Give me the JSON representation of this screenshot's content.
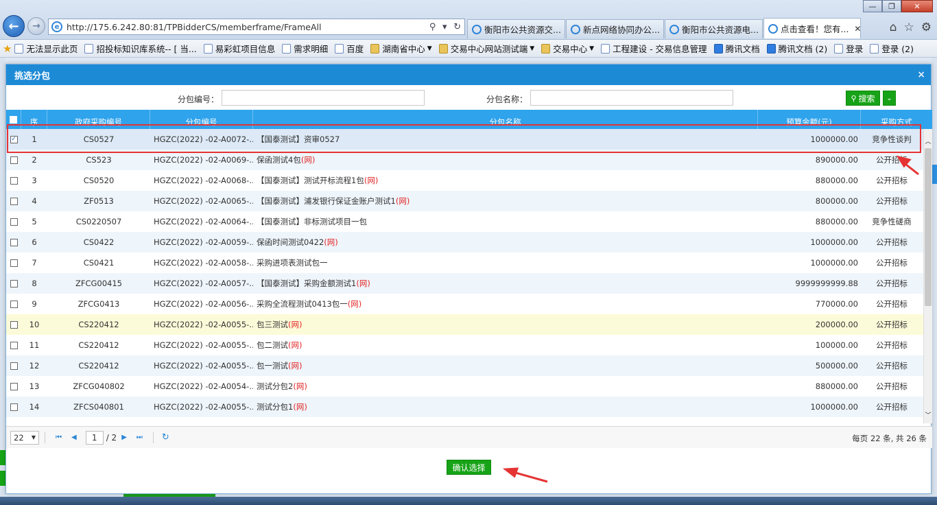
{
  "browser": {
    "url": "http://175.6.242.80:81/TPBidderCS/memberframe/FrameAll",
    "tabs": [
      {
        "label": "衡阳市公共资源交..."
      },
      {
        "label": "新点网络协同办公..."
      },
      {
        "label": "衡阳市公共资源电..."
      },
      {
        "label": "点击查看！您有..."
      }
    ],
    "favorites": [
      {
        "label": "无法显示此页",
        "icon": "ie-page"
      },
      {
        "label": "招投标知识库系统-- [ 当...",
        "icon": "ie-page"
      },
      {
        "label": "易彩虹项目信息",
        "icon": "ie-page"
      },
      {
        "label": "需求明细",
        "icon": "ie-page"
      },
      {
        "label": "百度",
        "icon": "ie-page"
      },
      {
        "label": "湖南省中心",
        "icon": "folder",
        "dropdown": true
      },
      {
        "label": "交易中心网站测试端",
        "icon": "folder",
        "dropdown": true
      },
      {
        "label": "交易中心",
        "icon": "folder",
        "dropdown": true
      },
      {
        "label": "工程建设 - 交易信息管理",
        "icon": "link"
      },
      {
        "label": "腾讯文档",
        "icon": "tencent"
      },
      {
        "label": "腾讯文档 (2)",
        "icon": "tencent"
      },
      {
        "label": "登录",
        "icon": "ie-page"
      },
      {
        "label": "登录 (2)",
        "icon": "ie-page"
      }
    ]
  },
  "dialog": {
    "title": "挑选分包",
    "close_glyph": "×",
    "search": {
      "code_label": "分包编号：",
      "code_value": "",
      "name_label": "分包名称：",
      "name_value": "",
      "search_button": "搜索"
    },
    "columns": [
      "序",
      "政府采购编号",
      "分包编号",
      "分包名称",
      "预算金额(元)",
      "采购方式"
    ],
    "rows": [
      {
        "seq": "1",
        "gov": "CS0527",
        "code": "HGZC(2022) -02-A0072-...",
        "name": "【国泰测试】资审0527",
        "net": "",
        "budget": "1000000.00",
        "method": "竞争性谈判",
        "checked": true
      },
      {
        "seq": "2",
        "gov": "CS523",
        "code": "HGZC(2022) -02-A0069-...",
        "name": "保函测试4包",
        "net": "(网)",
        "budget": "890000.00",
        "method": "公开招标",
        "checked": false
      },
      {
        "seq": "3",
        "gov": "CS0520",
        "code": "HGZC(2022) -02-A0068-...",
        "name": "【国泰测试】测试开标流程1包",
        "net": "(网)",
        "budget": "880000.00",
        "method": "公开招标",
        "checked": false
      },
      {
        "seq": "4",
        "gov": "ZF0513",
        "code": "HGZC(2022) -02-A0065-...",
        "name": "【国泰测试】浦发银行保证金账户测试1",
        "net": "(网)",
        "budget": "800000.00",
        "method": "公开招标",
        "checked": false
      },
      {
        "seq": "5",
        "gov": "CS0220507",
        "code": "HGZC(2022) -02-A0064-...",
        "name": "【国泰测试】非标测试项目一包",
        "net": "",
        "budget": "880000.00",
        "method": "竞争性磋商",
        "checked": false
      },
      {
        "seq": "6",
        "gov": "CS0422",
        "code": "HGZC(2022) -02-A0059-...",
        "name": "保函时间测试0422",
        "net": "(网)",
        "budget": "1000000.00",
        "method": "公开招标",
        "checked": false
      },
      {
        "seq": "7",
        "gov": "CS0421",
        "code": "HGZC(2022) -02-A0058-...",
        "name": "采购进项表测试包一",
        "net": "",
        "budget": "1000000.00",
        "method": "公开招标",
        "checked": false
      },
      {
        "seq": "8",
        "gov": "ZFCG00415",
        "code": "HGZC(2022) -02-A0057-...",
        "name": "【国泰测试】采购金额测试1",
        "net": "(网)",
        "budget": "9999999999.88",
        "method": "公开招标",
        "checked": false
      },
      {
        "seq": "9",
        "gov": "ZFCG0413",
        "code": "HGZC(2022) -02-A0056-...",
        "name": "采购全流程测试0413包一",
        "net": "(网)",
        "budget": "770000.00",
        "method": "公开招标",
        "checked": false
      },
      {
        "seq": "10",
        "gov": "CS220412",
        "code": "HGZC(2022) -02-A0055-...",
        "name": "包三测试",
        "net": "(网)",
        "budget": "200000.00",
        "method": "公开招标",
        "checked": false
      },
      {
        "seq": "11",
        "gov": "CS220412",
        "code": "HGZC(2022) -02-A0055-...",
        "name": "包二测试",
        "net": "(网)",
        "budget": "100000.00",
        "method": "公开招标",
        "checked": false
      },
      {
        "seq": "12",
        "gov": "CS220412",
        "code": "HGZC(2022) -02-A0055-...",
        "name": "包一测试",
        "net": "(网)",
        "budget": "500000.00",
        "method": "公开招标",
        "checked": false
      },
      {
        "seq": "13",
        "gov": "ZFCG040802",
        "code": "HGZC(2022) -02-A0054-...",
        "name": "测试分包2",
        "net": "(网)",
        "budget": "880000.00",
        "method": "公开招标",
        "checked": false
      },
      {
        "seq": "14",
        "gov": "ZFCS040801",
        "code": "HGZC(2022) -02-A0055-...",
        "name": "测试分包1",
        "net": "(网)",
        "budget": "1000000.00",
        "method": "公开招标",
        "checked": false
      }
    ],
    "pager": {
      "page_size": "22",
      "current_page": "1",
      "total_pages": "/ 2",
      "info": "每页 22 条, 共 26 条"
    },
    "confirm_button": "确认选择"
  },
  "colors": {
    "dialog_header": "#1d8ad6",
    "grid_header": "#2fa3ec",
    "green_button": "#17a317",
    "highlight_frame": "#e53333",
    "net_tag": "#e32727"
  }
}
